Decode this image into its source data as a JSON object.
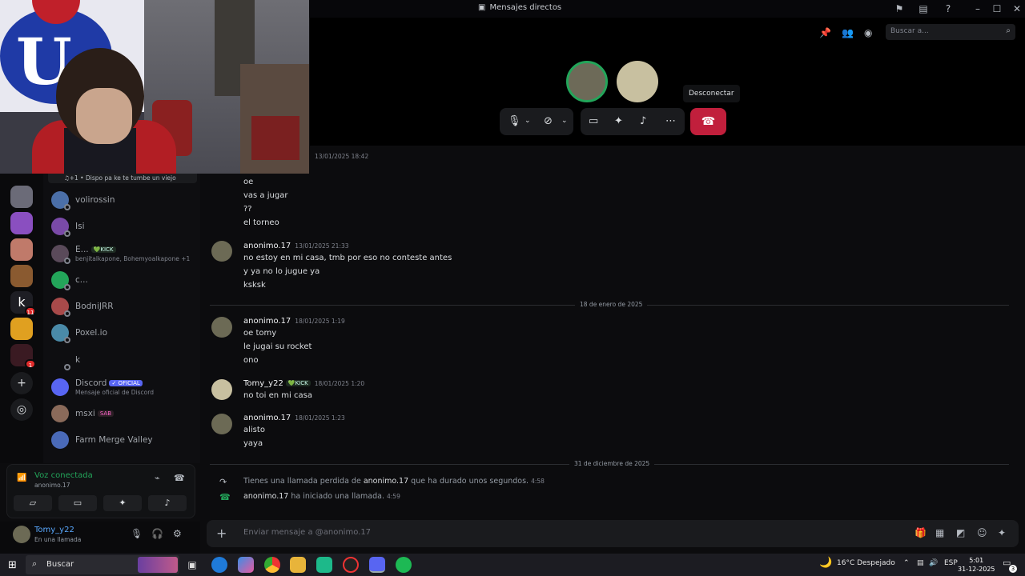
{
  "window": {
    "title": "Mensajes directos"
  },
  "server_rail": {
    "badges": [
      "11",
      "1"
    ]
  },
  "dm_list": {
    "top_item_status": "♫+1 • Dispo pa ke te tumbe un viejo",
    "items": [
      {
        "name": "volirossin",
        "sub": "",
        "tag": ""
      },
      {
        "name": "Isi",
        "sub": "",
        "tag": ""
      },
      {
        "name": "E...",
        "sub": "benjitalkapone, Bohemyoalkapone +1",
        "tag": "KICK"
      },
      {
        "name": "c...",
        "sub": "",
        "tag": ""
      },
      {
        "name": "BodniJRR",
        "sub": "",
        "tag": ""
      },
      {
        "name": "Poxel.io",
        "sub": "",
        "tag": ""
      },
      {
        "name": "k",
        "sub": "",
        "tag": ""
      },
      {
        "name": "Discord",
        "sub": "Mensaje oficial de Discord",
        "tag": "✓ OFICIAL"
      },
      {
        "name": "msxi",
        "sub": "",
        "tag": "SAB"
      },
      {
        "name": "Farm Merge Valley",
        "sub": "",
        "tag": ""
      }
    ]
  },
  "voice": {
    "status": "Voz conectada",
    "channel": "anonimo.17"
  },
  "user": {
    "name": "Tomy_y22",
    "status": "En una llamada"
  },
  "call": {
    "search_placeholder": "Buscar a...",
    "tooltip": "Desconectar"
  },
  "chat": {
    "first_timestamp": "13/01/2025 18:42",
    "early_lines": [
      "oe",
      "vas a jugar",
      "??",
      "el torneo"
    ],
    "messages": [
      {
        "author": "anonimo.17",
        "time": "13/01/2025 21:33",
        "tag": "",
        "lines": [
          "no estoy en mi casa, tmb por eso no conteste antes",
          "y ya no lo jugue ya",
          "ksksk"
        ]
      },
      {
        "author": "anonimo.17",
        "time": "18/01/2025 1:19",
        "tag": "",
        "lines": [
          "oe tomy",
          "le jugai su rocket",
          "ono"
        ]
      },
      {
        "author": "Tomy_y22",
        "time": "18/01/2025 1:20",
        "tag": "KICK",
        "lines": [
          "no toi en mi casa"
        ]
      },
      {
        "author": "anonimo.17",
        "time": "18/01/2025 1:23",
        "tag": "",
        "lines": [
          "alisto",
          "yaya"
        ]
      }
    ],
    "dividers": [
      "18 de enero de 2025",
      "31 de diciembre de 2025"
    ],
    "system": [
      {
        "prefix": "Tienes una llamada perdida de ",
        "who": "anonimo.17",
        "suffix": " que ha durado unos segundos.",
        "time": "4:58"
      },
      {
        "prefix": "",
        "who": "anonimo.17",
        "suffix": " ha iniciado una llamada.",
        "time": "4:59"
      }
    ],
    "input_placeholder": "Enviar mensaje a @anonimo.17"
  },
  "taskbar": {
    "search": "Buscar",
    "weather": "16°C  Despejado",
    "lang": "ESP",
    "time": "5:01",
    "date": "31-12-2025",
    "notif_count": "3"
  },
  "colors": {
    "accent": "#5865f2",
    "danger": "#c11f3c",
    "online": "#23a55a"
  }
}
